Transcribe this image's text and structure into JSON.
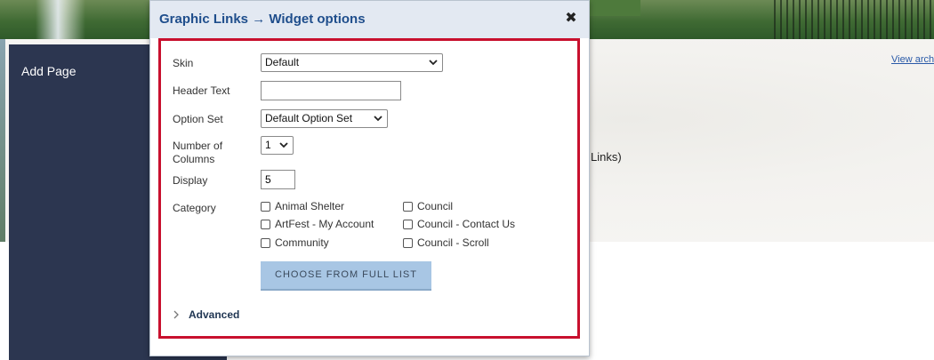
{
  "background": {
    "sidebar_label": "Add Page",
    "view_archive_label": "View arch",
    "links_text": "Links)"
  },
  "dialog": {
    "title": "Graphic Links → Widget options",
    "close_glyph": "✖",
    "accent_color": "#c8102e",
    "fields": {
      "skin": {
        "label": "Skin",
        "value": "Default"
      },
      "header_text": {
        "label": "Header Text",
        "value": ""
      },
      "option_set": {
        "label": "Option Set",
        "value": "Default Option Set"
      },
      "number_of_columns": {
        "label_line1": "Number of",
        "label_line2": "Columns",
        "value": "1"
      },
      "display": {
        "label": "Display",
        "value": "5"
      },
      "category": {
        "label": "Category",
        "options": [
          {
            "label": "Animal Shelter",
            "checked": false
          },
          {
            "label": "Council",
            "checked": false
          },
          {
            "label": "ArtFest - My Account",
            "checked": false
          },
          {
            "label": "Council - Contact Us",
            "checked": false
          },
          {
            "label": "Community",
            "checked": false
          },
          {
            "label": "Council - Scroll",
            "checked": false
          }
        ]
      }
    },
    "choose_button_label": "CHOOSE FROM FULL LIST",
    "advanced_label": "Advanced"
  }
}
